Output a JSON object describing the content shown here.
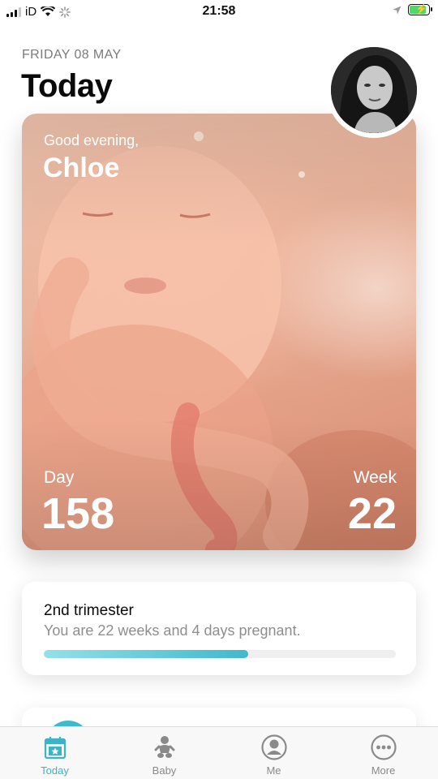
{
  "status_bar": {
    "carrier": "iD",
    "time": "21:58",
    "battery_color": "#4cd964"
  },
  "header": {
    "date": "FRIDAY 08 MAY",
    "title": "Today"
  },
  "hero": {
    "greeting": "Good evening,",
    "name": "Chloe",
    "day_label": "Day",
    "day_value": "158",
    "week_label": "Week",
    "week_value": "22"
  },
  "trimester": {
    "title": "2nd trimester",
    "subtitle": "You are 22 weeks and 4 days pregnant.",
    "progress_fraction": 0.58,
    "accent_color": "#3fb9cc"
  },
  "tabs": [
    {
      "label": "Today",
      "icon": "calendar-star-icon",
      "active": true
    },
    {
      "label": "Baby",
      "icon": "baby-icon",
      "active": false
    },
    {
      "label": "Me",
      "icon": "person-icon",
      "active": false
    },
    {
      "label": "More",
      "icon": "more-dots-icon",
      "active": false
    }
  ]
}
